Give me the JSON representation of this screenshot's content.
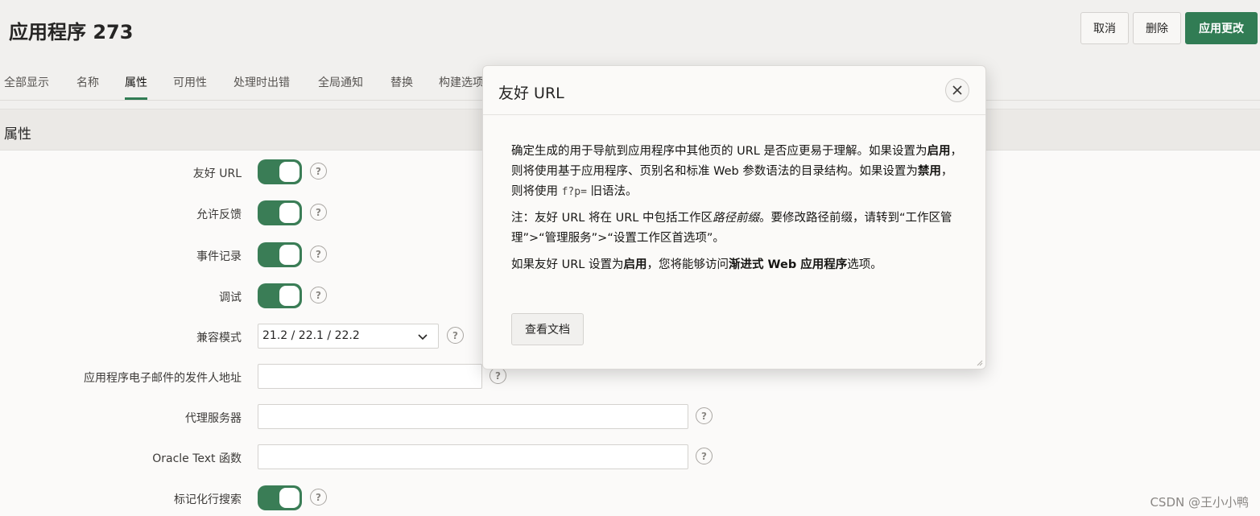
{
  "page": {
    "title": "应用程序 273"
  },
  "actions": {
    "cancel": "取消",
    "delete": "删除",
    "apply": "应用更改"
  },
  "tabs": [
    "全部显示",
    "名称",
    "属性",
    "可用性",
    "处理时出错",
    "全局通知",
    "替换",
    "构建选项"
  ],
  "active_tab": "属性",
  "region": {
    "title": "属性"
  },
  "fields": {
    "friendly_url": {
      "label": "友好 URL",
      "value": "on"
    },
    "allow_feedback": {
      "label": "允许反馈",
      "value": "on"
    },
    "logging": {
      "label": "事件记录",
      "value": "on"
    },
    "debugging": {
      "label": "调试",
      "value": "on"
    },
    "compat_mode": {
      "label": "兼容模式",
      "value": "21.2 / 22.1 / 22.2"
    },
    "email_from": {
      "label": "应用程序电子邮件的发件人地址",
      "value": ""
    },
    "proxy": {
      "label": "代理服务器",
      "value": ""
    },
    "oracle_text": {
      "label": "Oracle Text 函数",
      "value": ""
    },
    "tokenized_search": {
      "label": "标记化行搜索",
      "value": "on"
    }
  },
  "help_glyph": "?",
  "dialog": {
    "title": "友好 URL",
    "p1_a": "确定生成的用于导航到应用程序中其他页的 URL 是否应更易于理解。如果设置为",
    "p1_b": "启用",
    "p1_c": "，则将使用基于应用程序、页别名和标准 Web 参数语法的目录结构。如果设置为",
    "p1_d": "禁用",
    "p1_e": "，则将使用 ",
    "p1_code": "f?p=",
    "p1_f": " 旧语法。",
    "p2_a": "注：友好 URL 将在 URL 中包括工作区",
    "p2_b": "路径前缀",
    "p2_c": "。要修改路径前缀，请转到“工作区管理”>“管理服务”>“设置工作区首选项”。",
    "p3_a": "如果友好 URL 设置为",
    "p3_b": "启用",
    "p3_c": "，您将能够访问",
    "p3_d": "渐进式 Web 应用程序",
    "p3_e": "选项。",
    "doc_button": "查看文档"
  },
  "watermark": "CSDN @王小小鸭",
  "colors": {
    "accent": "#317c54",
    "toggle_on": "#3a7d56"
  }
}
